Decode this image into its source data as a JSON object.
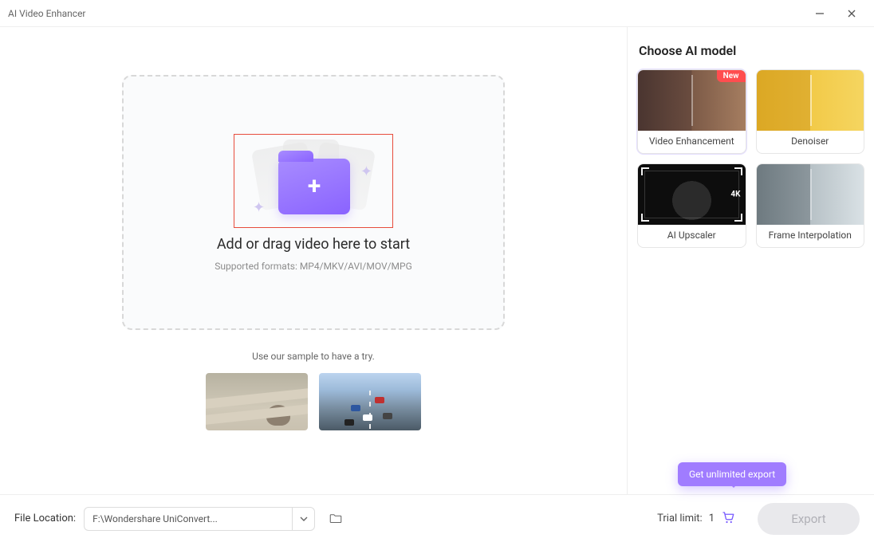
{
  "window": {
    "title": "AI Video Enhancer"
  },
  "drop": {
    "main": "Add or drag video here to start",
    "sub": "Supported formats: MP4/MKV/AVI/MOV/MPG"
  },
  "samples_hint": "Use our sample to have a try.",
  "right": {
    "heading": "Choose AI model",
    "models": {
      "enhance": {
        "label": "Video Enhancement",
        "badge": "New"
      },
      "denoiser": {
        "label": "Denoiser"
      },
      "upscaler": {
        "label": "AI Upscaler",
        "tag": "4K"
      },
      "interp": {
        "label": "Frame Interpolation"
      }
    }
  },
  "footer": {
    "file_location_label": "File Location:",
    "path": "F:\\Wondershare UniConvert...",
    "trial_label": "Trial limit:",
    "trial_value": "1",
    "export_label": "Export"
  },
  "tooltip": {
    "text": "Get unlimited export"
  }
}
